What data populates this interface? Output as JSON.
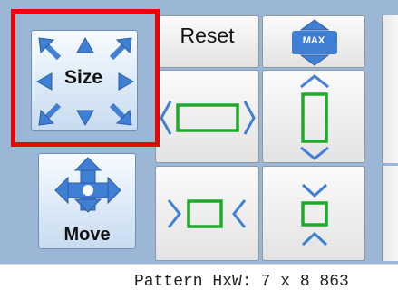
{
  "buttons": {
    "size_label": "Size",
    "move_label": "Move",
    "reset_label": "Reset",
    "max_label": "MAX"
  },
  "status": {
    "pattern_label": "Pattern HxW:",
    "pattern_value": "7 x 8 863"
  },
  "colors": {
    "panel_bg": "#9cb6d6",
    "arrow_blue": "#3f7fd4",
    "shape_green": "#1faa2b",
    "highlight_red": "#ee0000"
  },
  "icons": {
    "size": "resize-arrows-icon",
    "move": "move-arrows-icon",
    "max": "maximize-icon",
    "widen": "widen-icon",
    "narrow": "narrow-icon",
    "taller": "taller-icon",
    "shorter": "shorter-icon"
  }
}
